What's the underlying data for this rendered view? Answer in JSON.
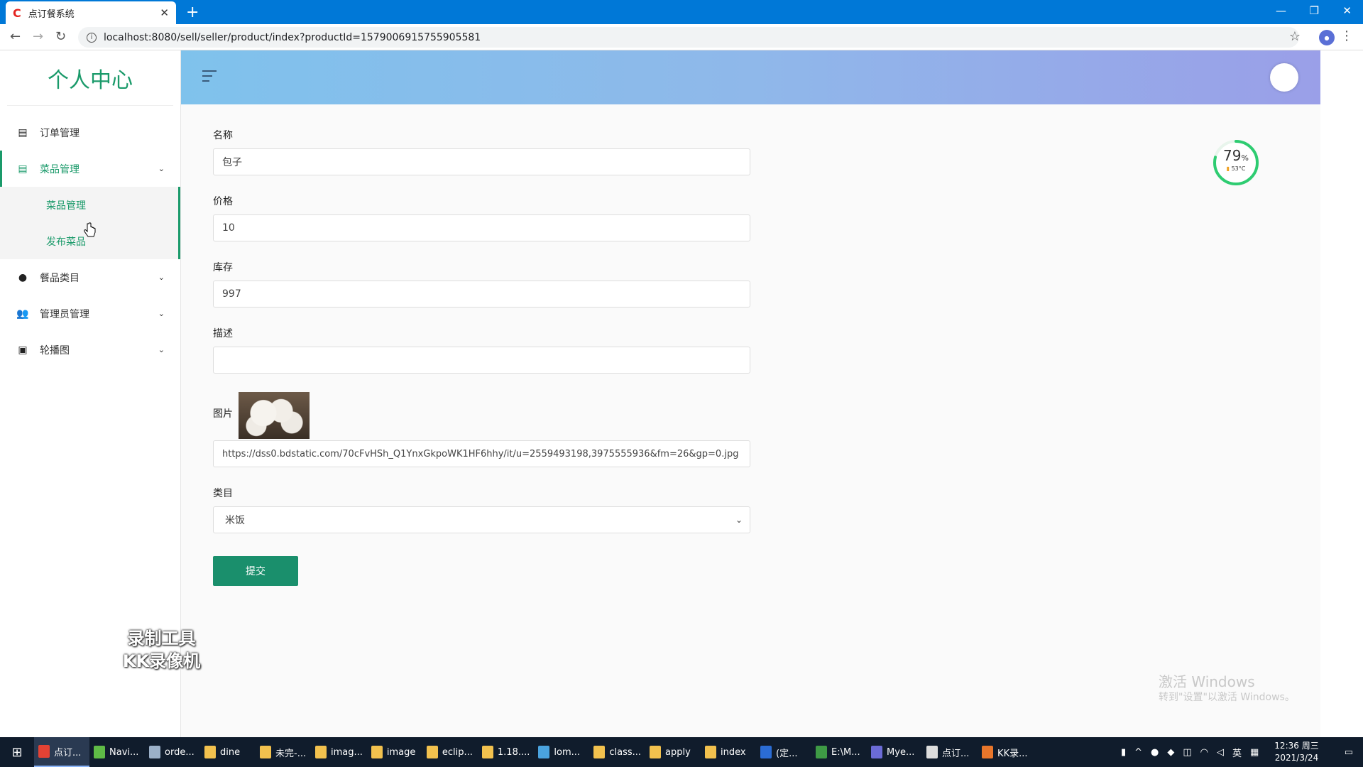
{
  "browser": {
    "tab_title": "点订餐系统",
    "url": "localhost:8080/sell/seller/product/index?productId=1579006915755905581"
  },
  "sidebar": {
    "brand": "个人中心",
    "items": [
      {
        "label": "订单管理"
      },
      {
        "label": "菜品管理"
      },
      {
        "label": "餐品类目"
      },
      {
        "label": "管理员管理"
      },
      {
        "label": "轮播图"
      }
    ],
    "sub_items": [
      {
        "label": "菜品管理"
      },
      {
        "label": "发布菜品"
      }
    ]
  },
  "form": {
    "name_label": "名称",
    "name_value": "包子",
    "price_label": "价格",
    "price_value": "10",
    "stock_label": "库存",
    "stock_value": "997",
    "desc_label": "描述",
    "desc_value": "",
    "image_label": "图片",
    "image_url": "https://dss0.bdstatic.com/70cFvHSh_Q1YnxGkpoWK1HF6hhy/it/u=2559493198,3975555936&fm=26&gp=0.jpg",
    "category_label": "类目",
    "category_value": "米饭",
    "submit_label": "提交"
  },
  "gauge": {
    "percent_text": "79",
    "percent_unit": "%",
    "temp": "53°C",
    "level": 0.79,
    "color": "#2ecc71"
  },
  "watermarks": {
    "activate_title": "激活 Windows",
    "activate_sub": "转到\"设置\"以激活 Windows。",
    "recorder_line1": "录制工具",
    "recorder_line2": "KK录像机"
  },
  "taskbar": {
    "items": [
      {
        "label": "点订...",
        "color": "#e34234"
      },
      {
        "label": "Navi...",
        "color": "#5fbb46"
      },
      {
        "label": "orde...",
        "color": "#9bb0c8"
      },
      {
        "label": "dine",
        "color": "#f2c14e"
      },
      {
        "label": "未完-...",
        "color": "#f2c14e"
      },
      {
        "label": "imag...",
        "color": "#f2c14e"
      },
      {
        "label": "image",
        "color": "#f2c14e"
      },
      {
        "label": "eclip...",
        "color": "#f2c14e"
      },
      {
        "label": "1.18....",
        "color": "#f2c14e"
      },
      {
        "label": "lom...",
        "color": "#4aa3df"
      },
      {
        "label": "class...",
        "color": "#f2c14e"
      },
      {
        "label": "apply",
        "color": "#f2c14e"
      },
      {
        "label": "index",
        "color": "#f2c14e"
      },
      {
        "label": "(定...",
        "color": "#2b6cd4"
      },
      {
        "label": "E:\\M...",
        "color": "#3e9a45"
      },
      {
        "label": "Mye...",
        "color": "#6b6bd6"
      },
      {
        "label": "点订...",
        "color": "#ddd"
      },
      {
        "label": "KK录...",
        "color": "#e8762b"
      }
    ],
    "ime": "英",
    "time": "12:36 周三",
    "date": "2021/3/24"
  }
}
